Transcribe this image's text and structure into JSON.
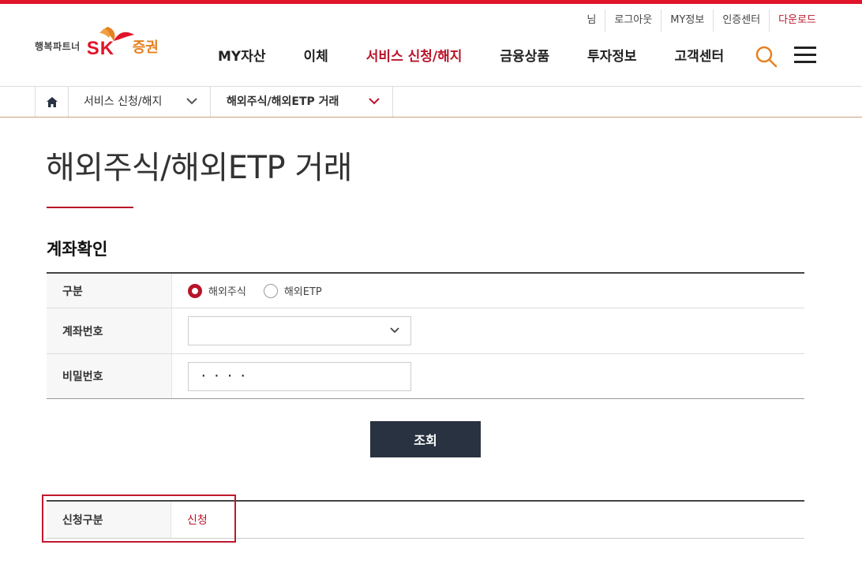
{
  "util_links": [
    "님",
    "로그아웃",
    "MY정보",
    "인증센터",
    "다운로드"
  ],
  "logo": {
    "tagline": "행복파트너",
    "brand": "SK",
    "brand_kr": "증권"
  },
  "nav": [
    "MY자산",
    "이체",
    "서비스 신청/해지",
    "금융상품",
    "투자정보",
    "고객센터"
  ],
  "nav_active_index": 2,
  "breadcrumb": {
    "level1": "서비스 신청/해지",
    "level2": "해외주식/해외ETP 거래"
  },
  "page_title": "해외주식/해외ETP 거래",
  "section_title": "계좌확인",
  "form": {
    "type_label": "구분",
    "type_options": [
      "해외주식",
      "해외ETP"
    ],
    "type_selected": "해외주식",
    "account_label": "계좌번호",
    "account_value": "",
    "password_label": "비밀번호",
    "password_value": "····"
  },
  "search_button": "조회",
  "result": {
    "label": "신청구분",
    "value": "신청"
  },
  "colors": {
    "accent": "#b9142a",
    "top_bar": "#e0152a",
    "button": "#293241",
    "brand_orange": "#e78020"
  }
}
